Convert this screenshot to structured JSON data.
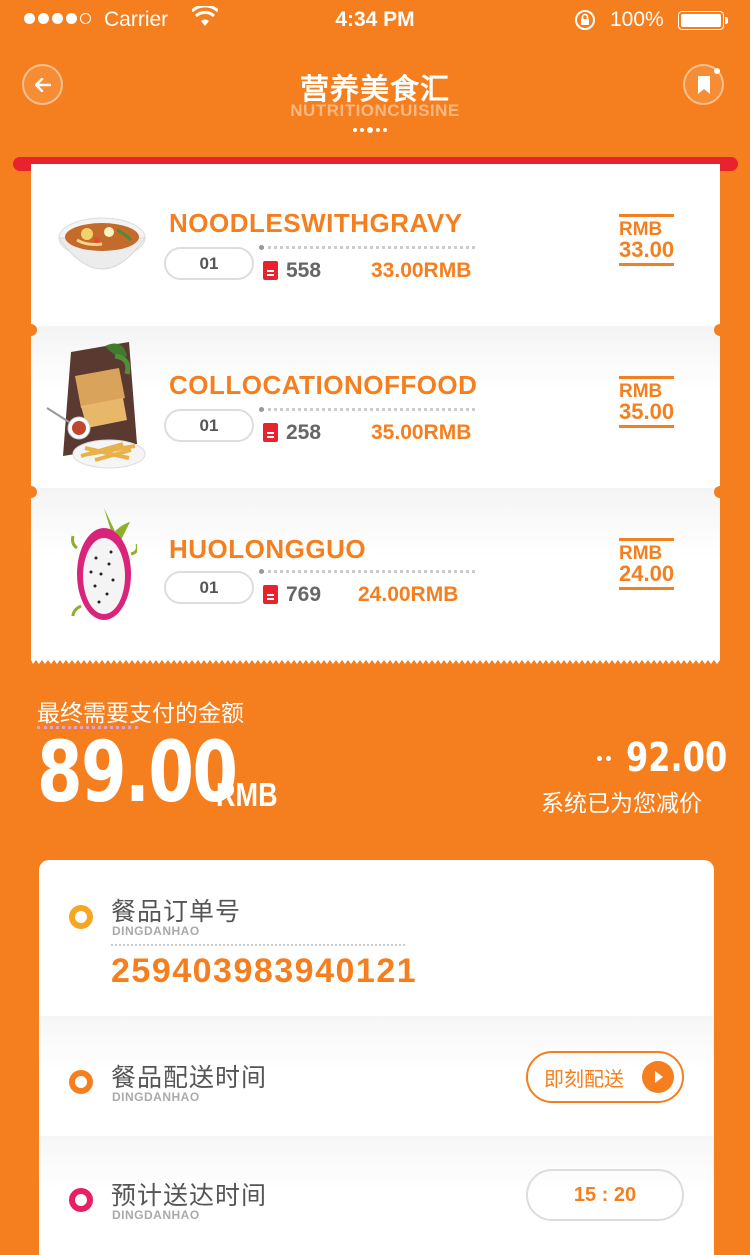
{
  "status_bar": {
    "carrier": "Carrier",
    "time": "4:34 PM",
    "battery": "100%"
  },
  "header": {
    "title": "营养美食汇",
    "subtitle": "NUTRITIONCUISINE"
  },
  "items": [
    {
      "name": "NOODLESWITHGRAVY",
      "qty": "01",
      "count": "558",
      "subtotal": "33.00RMB",
      "currency": "RMB",
      "price": "33.00",
      "image": "noodle-bowl"
    },
    {
      "name": "COLLOCATIONOFFOOD",
      "qty": "01",
      "count": "258",
      "subtotal": "35.00RMB",
      "currency": "RMB",
      "price": "35.00",
      "image": "food-platter"
    },
    {
      "name": "HUOLONGGUO",
      "qty": "01",
      "count": "769",
      "subtotal": "24.00RMB",
      "currency": "RMB",
      "price": "24.00",
      "image": "dragon-fruit"
    }
  ],
  "total": {
    "label": "最终需要支付的金额",
    "amount": "89.00",
    "unit": "RMB",
    "original": "92.00",
    "discount_label": "系统已为您减价"
  },
  "order": {
    "number_label": "餐品订单号",
    "number_sub": "DINGDANHAO",
    "number": "259403983940121",
    "delivery_label": "餐品配送时间",
    "delivery_sub": "DINGDANHAO",
    "delivery_button": "即刻配送",
    "eta_label": "预计送达时间",
    "eta_sub": "DINGDANHAO",
    "eta_value": "15 : 20"
  },
  "colors": {
    "accent": "#F57F1E",
    "red": "#E8232D",
    "bullet_yellow": "#F5A623",
    "bullet_orange": "#F57F1E",
    "bullet_pink": "#E91E63"
  }
}
